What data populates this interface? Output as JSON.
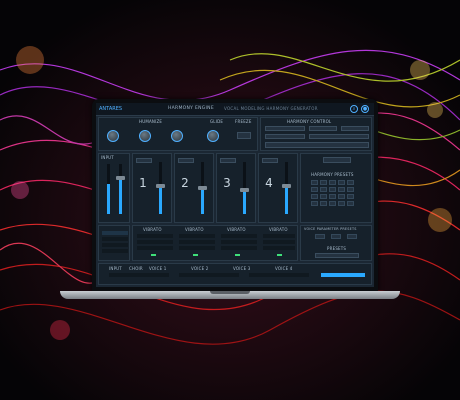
{
  "app": {
    "logo": "ANTARES",
    "title": "HARMONY ENGINE",
    "subtitle": "VOCAL MODELING HARMONY GENERATOR",
    "icons": [
      "search-icon",
      "settings-icon"
    ]
  },
  "sections": {
    "humanize": "HUMANIZE",
    "glide": "GLIDE",
    "freeze": "FREEZE",
    "harmony_control": "HARMONY CONTROL",
    "input": "INPUT",
    "harmony_presets": "HARMONY PRESETS",
    "voice_parameter_presets": "VOICE PARAMETER PRESETS",
    "choir": "CHOIR"
  },
  "voices": [
    {
      "number": "1",
      "label": "VOICE 1"
    },
    {
      "number": "2",
      "label": "VOICE 2"
    },
    {
      "number": "3",
      "label": "VOICE 3"
    },
    {
      "number": "4",
      "label": "VOICE 4"
    }
  ],
  "vibrato_label": "VIBRATO",
  "presets_label": "PRESETS",
  "colors": {
    "accent": "#2aa9ff",
    "led": "#3fe07a",
    "panel": "#16212b"
  }
}
